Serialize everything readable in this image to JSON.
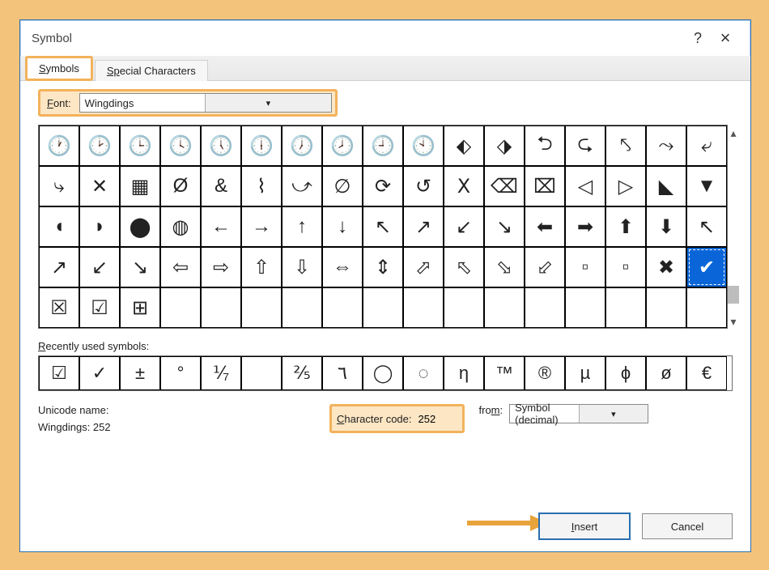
{
  "dialog": {
    "title": "Symbol",
    "help": "?",
    "close": "×"
  },
  "tabs": {
    "symbols": "ymbols",
    "symbols_u": "S",
    "special": "ecial Characters",
    "special_u": "Sp"
  },
  "font": {
    "label_u": "F",
    "label": "ont:",
    "value": "Wingdings"
  },
  "recent": {
    "label_u": "R",
    "label": "ecently used symbols:",
    "items": [
      "☑",
      "✓",
      "±",
      "°",
      "⅟₇",
      "",
      "⅖",
      "٦",
      "◯",
      "◌",
      "η",
      "™",
      "®",
      "µ",
      "ϕ",
      "ø",
      "€"
    ]
  },
  "meta": {
    "unicode_label": "Unicode name:",
    "unicode_value": "Wingdings: 252",
    "cc_label_u": "C",
    "cc_label": "haracter code:",
    "cc_value": "252",
    "from_label_u": "m",
    "from_label_pre": "fro",
    "from_label_post": ":",
    "from_value": "Symbol (decimal)"
  },
  "buttons": {
    "insert_u": "I",
    "insert": "nsert",
    "cancel": "Cancel"
  },
  "grid": {
    "rows": 5,
    "cols": 17,
    "selected": {
      "row": 3,
      "col": 16
    }
  }
}
